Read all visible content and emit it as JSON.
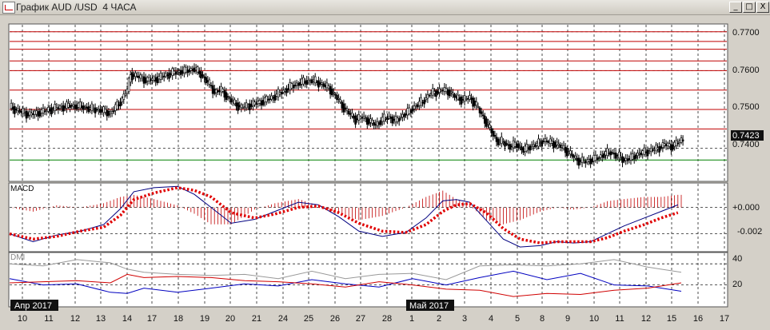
{
  "window": {
    "title": "График AUD /USD  4 ЧАСА",
    "buttons": [
      "_",
      "□",
      "X"
    ]
  },
  "price_panel": {
    "y_ticks": [
      "0.7700",
      "0.7600",
      "0.7500",
      "0.7400"
    ],
    "current_price": "0.7423",
    "colors": {
      "bull": "#ffffff",
      "bear": "#000000",
      "resistance": "#c00000",
      "support": "#008000"
    }
  },
  "macd_panel": {
    "title": "MACD",
    "y_ticks": [
      "+0.000",
      "-0.002"
    ]
  },
  "dmi_panel": {
    "title": "DMI",
    "y_ticks": [
      "40",
      "20"
    ]
  },
  "x_axis": {
    "ticks": [
      "10",
      "11",
      "12",
      "13",
      "14",
      "17",
      "18",
      "19",
      "20",
      "21",
      "24",
      "25",
      "26",
      "27",
      "28",
      "1",
      "2",
      "3",
      "4",
      "5",
      "8",
      "9",
      "10",
      "11",
      "12",
      "15",
      "16",
      "17"
    ],
    "month_labels": [
      "Апр 2017",
      "Май 2017"
    ]
  },
  "chart_data": {
    "type": "candlestick",
    "symbol": "AUD/USD",
    "timeframe": "4 ЧАСА",
    "ylim": [
      0.7315,
      0.772
    ],
    "horizontal_levels": [
      0.77,
      0.7675,
      0.7655,
      0.7625,
      0.76,
      0.755,
      0.75,
      0.745,
      0.737
    ],
    "close_path": [
      [
        0,
        0.7507
      ],
      [
        6,
        0.7495
      ],
      [
        12,
        0.7487
      ],
      [
        18,
        0.7493
      ],
      [
        24,
        0.75
      ],
      [
        30,
        0.7505
      ],
      [
        36,
        0.751
      ],
      [
        42,
        0.7508
      ],
      [
        48,
        0.7502
      ],
      [
        54,
        0.7498
      ],
      [
        60,
        0.749
      ],
      [
        66,
        0.752
      ],
      [
        70,
        0.755
      ],
      [
        72,
        0.759
      ],
      [
        76,
        0.7585
      ],
      [
        82,
        0.7575
      ],
      [
        88,
        0.758
      ],
      [
        94,
        0.759
      ],
      [
        100,
        0.7597
      ],
      [
        106,
        0.76
      ],
      [
        110,
        0.7605
      ],
      [
        114,
        0.759
      ],
      [
        118,
        0.757
      ],
      [
        122,
        0.7545
      ],
      [
        126,
        0.755
      ],
      [
        130,
        0.753
      ],
      [
        134,
        0.7515
      ],
      [
        138,
        0.7505
      ],
      [
        142,
        0.751
      ],
      [
        146,
        0.7515
      ],
      [
        150,
        0.752
      ],
      [
        156,
        0.753
      ],
      [
        162,
        0.7545
      ],
      [
        168,
        0.756
      ],
      [
        174,
        0.757
      ],
      [
        180,
        0.7575
      ],
      [
        186,
        0.7565
      ],
      [
        190,
        0.7555
      ],
      [
        194,
        0.7535
      ],
      [
        198,
        0.751
      ],
      [
        202,
        0.749
      ],
      [
        206,
        0.7475
      ],
      [
        210,
        0.748
      ],
      [
        214,
        0.747
      ],
      [
        218,
        0.746
      ],
      [
        222,
        0.7475
      ],
      [
        226,
        0.748
      ],
      [
        230,
        0.747
      ],
      [
        234,
        0.7485
      ],
      [
        238,
        0.7495
      ],
      [
        242,
        0.751
      ],
      [
        246,
        0.752
      ],
      [
        250,
        0.754
      ],
      [
        254,
        0.7545
      ],
      [
        258,
        0.755
      ],
      [
        262,
        0.7545
      ],
      [
        266,
        0.753
      ],
      [
        270,
        0.7525
      ],
      [
        274,
        0.753
      ],
      [
        278,
        0.751
      ],
      [
        282,
        0.748
      ],
      [
        286,
        0.745
      ],
      [
        290,
        0.742
      ],
      [
        294,
        0.7415
      ],
      [
        298,
        0.7405
      ],
      [
        302,
        0.741
      ],
      [
        306,
        0.7395
      ],
      [
        310,
        0.7405
      ],
      [
        314,
        0.741
      ],
      [
        318,
        0.742
      ],
      [
        322,
        0.7415
      ],
      [
        326,
        0.741
      ],
      [
        330,
        0.74
      ],
      [
        334,
        0.7385
      ],
      [
        338,
        0.737
      ],
      [
        342,
        0.7365
      ],
      [
        346,
        0.737
      ],
      [
        350,
        0.7375
      ],
      [
        354,
        0.7385
      ],
      [
        358,
        0.739
      ],
      [
        362,
        0.738
      ],
      [
        366,
        0.737
      ],
      [
        370,
        0.7375
      ],
      [
        374,
        0.7385
      ],
      [
        378,
        0.739
      ],
      [
        382,
        0.7395
      ],
      [
        386,
        0.74
      ],
      [
        390,
        0.741
      ],
      [
        394,
        0.7405
      ],
      [
        398,
        0.7415
      ],
      [
        401,
        0.7423
      ]
    ],
    "macd_ylim": [
      -0.0033,
      0.0018
    ],
    "macd_line": [
      [
        0,
        -0.002
      ],
      [
        14,
        -0.0026
      ],
      [
        28,
        -0.0021
      ],
      [
        42,
        -0.0018
      ],
      [
        56,
        -0.0013
      ],
      [
        66,
        -0.0001
      ],
      [
        74,
        0.0012
      ],
      [
        86,
        0.0015
      ],
      [
        100,
        0.0016
      ],
      [
        110,
        0.001
      ],
      [
        120,
        0.0
      ],
      [
        132,
        -0.0012
      ],
      [
        146,
        -0.0009
      ],
      [
        158,
        -0.0003
      ],
      [
        172,
        0.0004
      ],
      [
        184,
        0.0002
      ],
      [
        196,
        -0.0007
      ],
      [
        208,
        -0.0018
      ],
      [
        222,
        -0.0022
      ],
      [
        236,
        -0.0019
      ],
      [
        248,
        -0.0008
      ],
      [
        258,
        0.0005
      ],
      [
        266,
        0.0006
      ],
      [
        274,
        0.0004
      ],
      [
        284,
        -0.001
      ],
      [
        294,
        -0.0024
      ],
      [
        304,
        -0.003
      ],
      [
        316,
        -0.0029
      ],
      [
        326,
        -0.0026
      ],
      [
        336,
        -0.0027
      ],
      [
        346,
        -0.0026
      ],
      [
        356,
        -0.002
      ],
      [
        366,
        -0.0014
      ],
      [
        378,
        -0.0008
      ],
      [
        388,
        -0.0003
      ],
      [
        398,
        0.0002
      ]
    ],
    "macd_signal": [
      [
        0,
        -0.002
      ],
      [
        14,
        -0.0024
      ],
      [
        28,
        -0.0022
      ],
      [
        42,
        -0.0018
      ],
      [
        56,
        -0.0015
      ],
      [
        66,
        -0.0006
      ],
      [
        74,
        0.0006
      ],
      [
        86,
        0.0011
      ],
      [
        100,
        0.0015
      ],
      [
        110,
        0.0013
      ],
      [
        120,
        0.0008
      ],
      [
        132,
        -0.0004
      ],
      [
        146,
        -0.0008
      ],
      [
        158,
        -0.0005
      ],
      [
        172,
        0.0
      ],
      [
        184,
        0.0001
      ],
      [
        196,
        -0.0004
      ],
      [
        208,
        -0.0012
      ],
      [
        222,
        -0.0018
      ],
      [
        236,
        -0.0019
      ],
      [
        248,
        -0.0013
      ],
      [
        258,
        -0.0003
      ],
      [
        266,
        0.0002
      ],
      [
        274,
        0.0003
      ],
      [
        284,
        -0.0004
      ],
      [
        294,
        -0.0016
      ],
      [
        304,
        -0.0024
      ],
      [
        316,
        -0.0027
      ],
      [
        326,
        -0.0026
      ],
      [
        336,
        -0.0026
      ],
      [
        346,
        -0.0026
      ],
      [
        356,
        -0.0023
      ],
      [
        366,
        -0.0018
      ],
      [
        378,
        -0.0013
      ],
      [
        388,
        -0.0008
      ],
      [
        398,
        -0.0004
      ]
    ],
    "dmi_ylim": [
      0,
      50
    ],
    "adx_line": [
      [
        0,
        40
      ],
      [
        20,
        38
      ],
      [
        40,
        44
      ],
      [
        60,
        41
      ],
      [
        70,
        35
      ],
      [
        80,
        32
      ],
      [
        100,
        30
      ],
      [
        120,
        29
      ],
      [
        140,
        30
      ],
      [
        160,
        26
      ],
      [
        180,
        33
      ],
      [
        200,
        26
      ],
      [
        220,
        30
      ],
      [
        240,
        31
      ],
      [
        260,
        25
      ],
      [
        280,
        38
      ],
      [
        300,
        39
      ],
      [
        320,
        38
      ],
      [
        340,
        40
      ],
      [
        360,
        44
      ],
      [
        380,
        37
      ],
      [
        400,
        32
      ]
    ],
    "plus_di": [
      [
        0,
        26
      ],
      [
        20,
        20
      ],
      [
        40,
        21
      ],
      [
        60,
        13
      ],
      [
        70,
        12
      ],
      [
        80,
        17
      ],
      [
        100,
        13
      ],
      [
        120,
        17
      ],
      [
        140,
        21
      ],
      [
        160,
        19
      ],
      [
        180,
        25
      ],
      [
        200,
        21
      ],
      [
        220,
        18
      ],
      [
        240,
        26
      ],
      [
        260,
        20
      ],
      [
        280,
        27
      ],
      [
        300,
        33
      ],
      [
        320,
        25
      ],
      [
        340,
        31
      ],
      [
        360,
        20
      ],
      [
        380,
        19
      ],
      [
        400,
        14
      ]
    ],
    "minus_di": [
      [
        0,
        22
      ],
      [
        20,
        23
      ],
      [
        40,
        24
      ],
      [
        60,
        22
      ],
      [
        70,
        30
      ],
      [
        80,
        27
      ],
      [
        100,
        28
      ],
      [
        120,
        27
      ],
      [
        140,
        24
      ],
      [
        160,
        23
      ],
      [
        180,
        21
      ],
      [
        200,
        18
      ],
      [
        220,
        23
      ],
      [
        240,
        20
      ],
      [
        260,
        16
      ],
      [
        280,
        15
      ],
      [
        300,
        9
      ],
      [
        320,
        12
      ],
      [
        340,
        11
      ],
      [
        360,
        15
      ],
      [
        380,
        17
      ],
      [
        400,
        22
      ]
    ]
  }
}
